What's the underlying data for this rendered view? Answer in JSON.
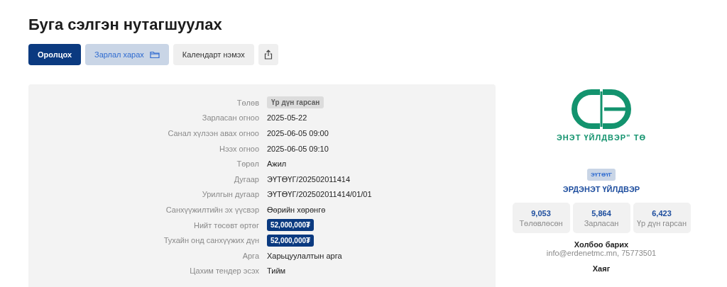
{
  "title": "Буга сэлгэн нутагшуулах",
  "actions": [
    {
      "label": "Оролцох",
      "kind": "primary"
    },
    {
      "label": "Зарлал харах",
      "kind": "folder"
    },
    {
      "label": "Календарт нэмэх",
      "kind": "plain"
    },
    {
      "kind": "share"
    }
  ],
  "details": [
    {
      "label": "Төлөв",
      "value": "Үр дүн гарсан",
      "kind": "status"
    },
    {
      "label": "Зарласан огноо",
      "value": "2025-05-22",
      "kind": "text"
    },
    {
      "label": "Санал хүлээн авах огноо",
      "value": "2025-06-05 09:00",
      "kind": "text"
    },
    {
      "label": "Нээх огноо",
      "value": "2025-06-05 09:10",
      "kind": "text"
    },
    {
      "label": "Төрөл",
      "value": "Ажил",
      "kind": "text"
    },
    {
      "label": "Дугаар",
      "value": "ЭҮТӨҮГ/202502011414",
      "kind": "text"
    },
    {
      "label": "Урилгын дугаар",
      "value": "ЭҮТӨҮГ/202502011414/01/01",
      "kind": "text"
    },
    {
      "label": "Санхүүжилтийн эх үүсвэр",
      "value": "Өөрийн хөрөнгө",
      "kind": "text"
    },
    {
      "label": "Нийт төсөвт өртөг",
      "value": "52,000,000₮",
      "kind": "amount"
    },
    {
      "label": "Тухайн онд санхүүжих дүн",
      "value": "52,000,000₮",
      "kind": "amount"
    },
    {
      "label": "Арга",
      "value": "Харьцуулалтын арга",
      "kind": "text"
    },
    {
      "label": "Цахим тендер эсэх",
      "value": "Тийм",
      "kind": "text"
    }
  ],
  "organization": {
    "logo_text": "ЭНЭТ ҮЙЛДВЭР” ТӨ",
    "code": "ЭҮТӨҮГ",
    "name": "ЭРДЭНЭТ ҮЙЛДВЭР",
    "stats": [
      {
        "value": "9,053",
        "label": "Төлөвлөсөн"
      },
      {
        "value": "5,864",
        "label": "Зарласан"
      },
      {
        "value": "6,423",
        "label": "Үр дүн гарсан"
      }
    ],
    "contact_heading": "Холбоо барих",
    "contact": "info@erdenetmc.mn, 75773501",
    "address_heading": "Хаяг"
  }
}
